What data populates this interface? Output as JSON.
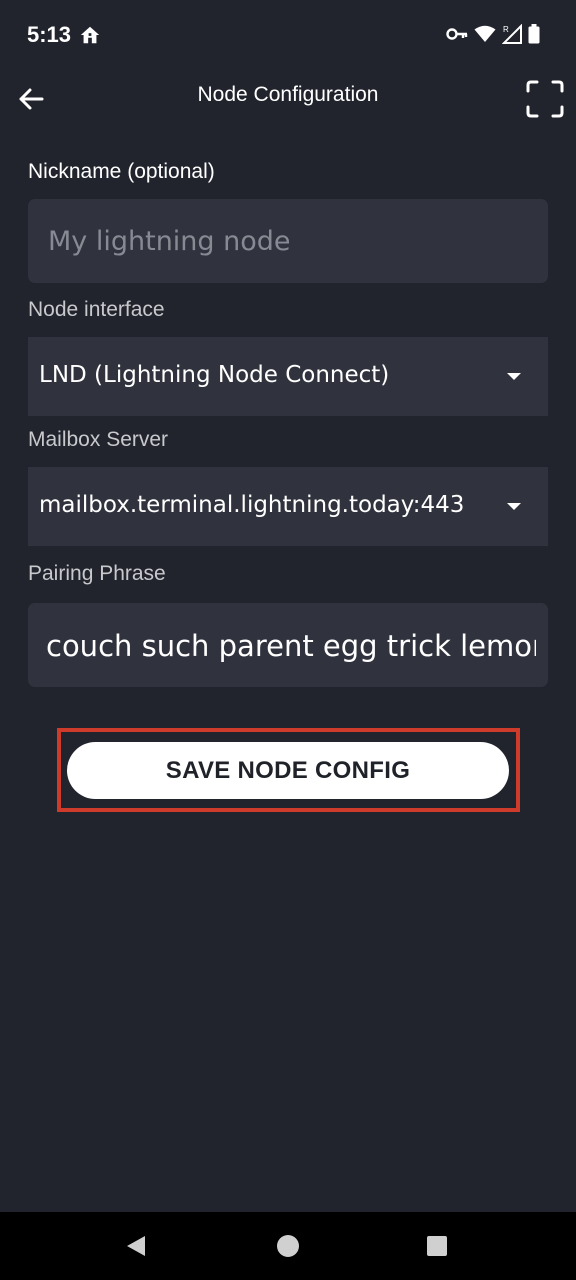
{
  "status_bar": {
    "time": "5:13",
    "icons": [
      "home-icon",
      "key-icon",
      "wifi-icon",
      "signal-roaming-icon",
      "battery-icon"
    ],
    "roaming_letter": "R"
  },
  "app_bar": {
    "title": "Node Configuration",
    "back_icon": "arrow-left-icon",
    "scan_icon": "scan-frame-icon"
  },
  "form": {
    "nickname": {
      "label": "Nickname (optional)",
      "placeholder": "My lightning node",
      "value": ""
    },
    "node_interface": {
      "label": "Node interface",
      "value": "LND (Lightning Node Connect)"
    },
    "mailbox_server": {
      "label": "Mailbox Server",
      "value": "mailbox.terminal.lightning.today:443"
    },
    "pairing_phrase": {
      "label": "Pairing Phrase",
      "value": "couch such parent egg trick lemon"
    }
  },
  "save_button": {
    "label": "SAVE NODE CONFIG"
  },
  "colors": {
    "background": "#21242d",
    "field_background": "#30333d",
    "button_background": "#ffffff",
    "highlight": "#cf3b2a"
  },
  "nav_bar": {
    "icons": [
      "nav-back-icon",
      "nav-home-icon",
      "nav-recents-icon"
    ]
  }
}
